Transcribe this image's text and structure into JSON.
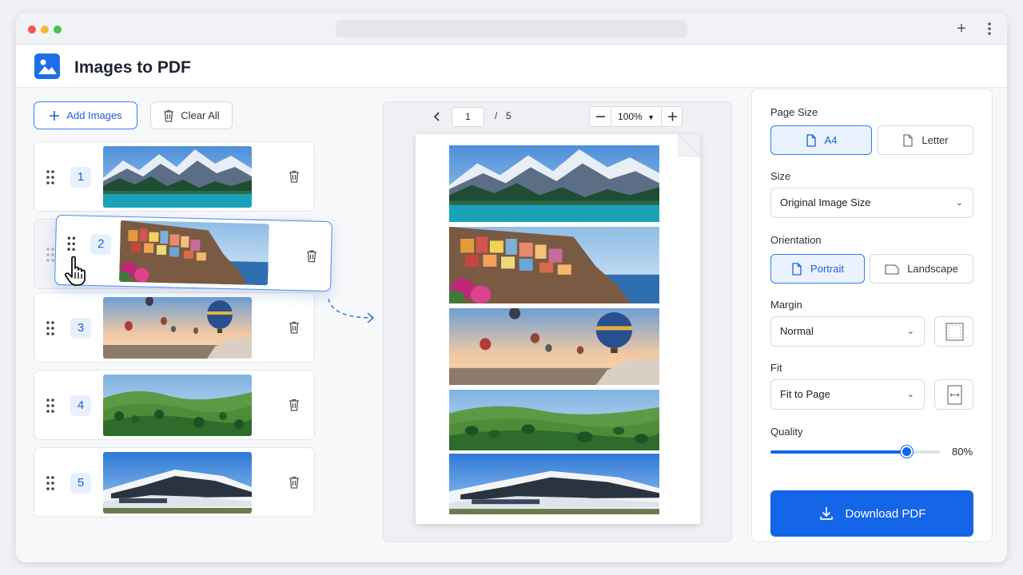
{
  "app": {
    "title": "Images to PDF"
  },
  "toolbar": {
    "add_label": "Add Images",
    "clear_label": "Clear All"
  },
  "images": [
    {
      "index": "1",
      "scene": "mountain-lake"
    },
    {
      "index": "2",
      "scene": "coastal-village"
    },
    {
      "index": "3",
      "scene": "hot-air-balloons"
    },
    {
      "index": "4",
      "scene": "green-hills"
    },
    {
      "index": "5",
      "scene": "modern-building"
    }
  ],
  "preview": {
    "current_page": "1",
    "page_sep": "/",
    "total_pages": "5",
    "zoom": "100%"
  },
  "settings": {
    "page_size_label": "Page Size",
    "page_size_options": [
      "A4",
      "Letter"
    ],
    "page_size_selected": "A4",
    "size_label": "Size",
    "size_value": "Original Image Size",
    "orientation_label": "Orientation",
    "orientation_options": [
      "Portrait",
      "Landscape"
    ],
    "orientation_selected": "Portrait",
    "margin_label": "Margin",
    "margin_value": "Normal",
    "fit_label": "Fit",
    "fit_value": "Fit to Page",
    "quality_label": "Quality",
    "quality_value": 0.8,
    "quality_text": "80%",
    "download_label": "Download PDF"
  },
  "colors": {
    "accent": "#1565e8",
    "accent_light": "#eaf2fe"
  },
  "icons": [
    "image-icon",
    "plus-icon",
    "trash-icon",
    "grip-icon",
    "hand-cursor-icon",
    "chevron-left-icon",
    "minus-icon",
    "chevron-down-icon",
    "document-icon",
    "download-icon",
    "dashed-arrow-icon"
  ]
}
